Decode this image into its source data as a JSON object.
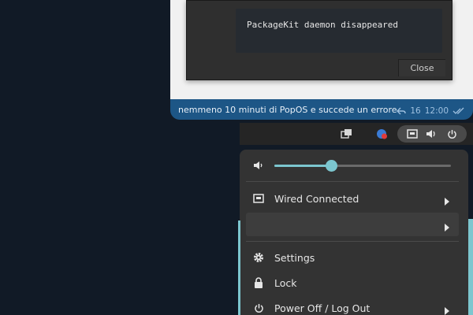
{
  "chat": {
    "error_text": "PackageKit daemon disappeared",
    "close_label": "Close",
    "message_text": "nemmeno 10 minuti di PopOS e succede un errore",
    "reply_count": "16",
    "time": "12:00"
  },
  "menu": {
    "volume_level": 0.32,
    "wired_label": "Wired Connected",
    "settings_label": "Settings",
    "lock_label": "Lock",
    "power_label": "Power Off / Log Out"
  },
  "colors": {
    "accent": "#7cc6cf",
    "chat_bubble": "#1d5686",
    "background": "#111a26",
    "notification_badge": "#e03b3b"
  },
  "icons": {
    "reply": "reply-icon",
    "read_receipt": "double-check-icon",
    "workspaces": "workspaces-icon",
    "app_indicator": "app-indicator-icon",
    "network": "network-wired-icon",
    "volume": "volume-icon",
    "power": "power-icon",
    "settings": "gear-icon",
    "lock": "lock-icon",
    "submenu": "chevron-right-icon"
  }
}
